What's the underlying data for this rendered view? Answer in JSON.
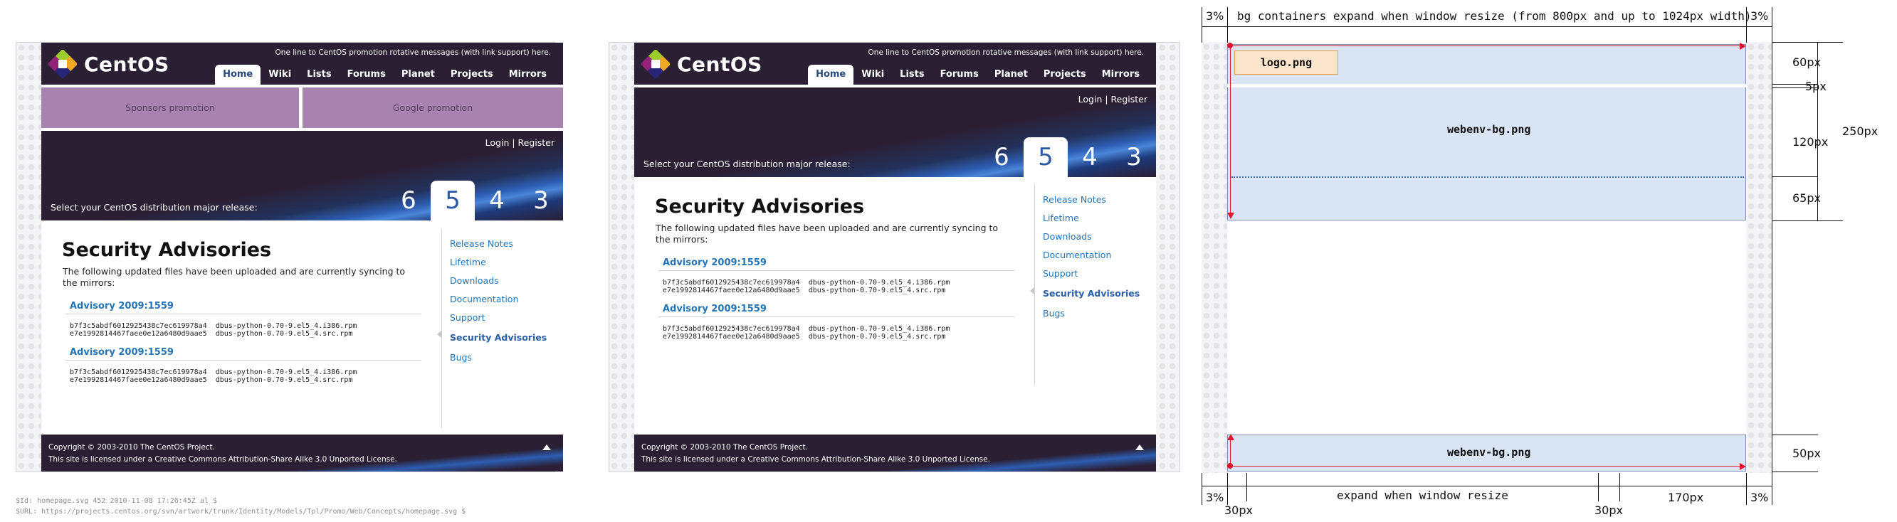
{
  "logo_text": "CentOS",
  "promo_line": "One line to CentOS promotion rotative messages (with link support) here.",
  "nav": [
    "Home",
    "Wiki",
    "Lists",
    "Forums",
    "Planet",
    "Projects",
    "Mirrors"
  ],
  "promos": {
    "sponsors": "Sponsors promotion",
    "google": "Google promotion"
  },
  "login_register": "Login | Register",
  "select_release": "Select your CentOS distribution major release:",
  "releases": [
    "6",
    "5",
    "4",
    "3"
  ],
  "page_title": "Security Advisories",
  "lead": "The following updated files have been uploaded and are currently syncing to the mirrors:",
  "advisories": [
    {
      "title": "Advisory 2009:1559",
      "lines": "b7f3c5abdf6012925438c7ec619978a4  dbus-python-0.70-9.el5_4.i386.rpm\ne7e1992814467faee0e12a6480d9aae5  dbus-python-0.70-9.el5_4.src.rpm"
    },
    {
      "title": "Advisory 2009:1559",
      "lines": "b7f3c5abdf6012925438c7ec619978a4  dbus-python-0.70-9.el5_4.i386.rpm\ne7e1992814467faee0e12a6480d9aae5  dbus-python-0.70-9.el5_4.src.rpm"
    }
  ],
  "sidebar": [
    "Release Notes",
    "Lifetime",
    "Downloads",
    "Documentation",
    "Support",
    "Security Advisories",
    "Bugs"
  ],
  "sidebar_active_index": 5,
  "footer": {
    "line1": "Copyright © 2003-2010 The CentOS Project.",
    "line2": "This site is licensed under a  Creative Commons Attribution-Share Alike 3.0 Unported License."
  },
  "meta": {
    "id": "$Id: homepage.svg 452 2010-11-08 17:26:45Z al $",
    "url": "$URL: https://projects.centos.org/svn/artwork/trunk/Identity/Models/Tpl/Promo/Web/Concepts/homepage.svg $"
  },
  "diagram": {
    "top_label": "bg containers expand when window resize (from 800px and up to 1024px width)",
    "bottom_label": "expand when window resize",
    "pct": "3%",
    "logo": "logo.png",
    "webenv": "webenv-bg.png",
    "heights": [
      "60px",
      "5px",
      "120px",
      "65px",
      "250px",
      "50px"
    ],
    "widths": [
      "30px",
      "30px",
      "170px"
    ]
  },
  "colors": {
    "dark": "#2b1f33",
    "promo": "#a883b0",
    "link": "#2574b5",
    "accent_blue": "#2d5eb3",
    "diagram_fill": "#d9e4f4",
    "guide_red": "#e0142a"
  }
}
